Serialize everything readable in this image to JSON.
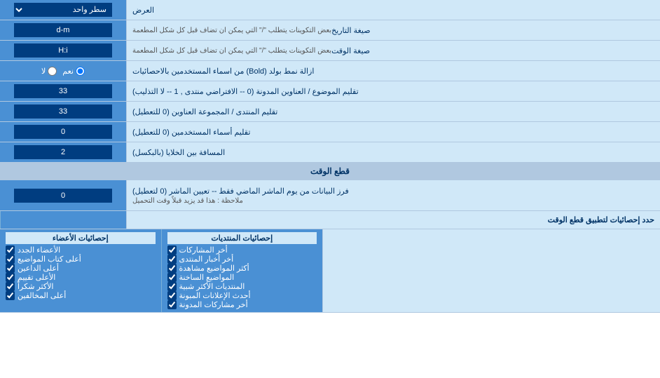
{
  "page": {
    "title": "العرض",
    "rows": [
      {
        "id": "display_mode",
        "label": "العرض",
        "input_type": "select",
        "value": "سطر واحد"
      },
      {
        "id": "date_format",
        "label": "صيغة التاريخ",
        "sublabel": "بعض التكوينات يتطلب \"/\" التي يمكن ان تضاف قبل كل شكل المطعمة",
        "input_type": "text",
        "value": "d-m"
      },
      {
        "id": "time_format",
        "label": "صيغة الوقت",
        "sublabel": "بعض التكوينات يتطلب \"/\" التي يمكن ان تضاف قبل كل شكل المطعمة",
        "input_type": "text",
        "value": "H:i"
      },
      {
        "id": "bold_remove",
        "label": "ازالة نمط بولد (Bold) من اسماء المستخدمين بالاحصائيات",
        "input_type": "radio",
        "options": [
          "نعم",
          "لا"
        ],
        "selected": "نعم"
      },
      {
        "id": "topic_subject_align",
        "label": "تقليم الموضوع / العناوين المدونة (0 -- الافتراضي منتدى , 1 -- لا التذليب)",
        "input_type": "text",
        "value": "33"
      },
      {
        "id": "forum_header_align",
        "label": "تقليم المنتدى / المجموعة العناوين (0 للتعطيل)",
        "input_type": "text",
        "value": "33"
      },
      {
        "id": "username_trim",
        "label": "تقليم أسماء المستخدمين (0 للتعطيل)",
        "input_type": "text",
        "value": "0"
      },
      {
        "id": "cell_spacing",
        "label": "المسافة بين الخلايا (بالبكسل)",
        "input_type": "text",
        "value": "2"
      }
    ],
    "realtime_section": {
      "title": "قطع الوقت",
      "realtime_row": {
        "label": "فرز البيانات من يوم الماشر الماضي فقط -- تعيين الماشر (0 لتعطيل)",
        "note": "ملاحظة : هذا قد يزيد قبلاً وقت التحميل",
        "value": "0"
      },
      "apply_label": "حدد إحصائيات لتطبيق قطع الوقت"
    },
    "checkboxes": {
      "col1_header": "إحصائيات المنتديات",
      "col2_header": "إحصائيات الأعضاء",
      "col1_items": [
        "أخر المشاركات",
        "أخر أخبار المنتدى",
        "أكثر المواضيع مشاهدة",
        "المواضيع الساخنة",
        "المنتديات الأكثر شبية",
        "أحدث الإعلانات المبونة",
        "أخر مشاركات المدونة"
      ],
      "col2_items": [
        "الأعضاء الجدد",
        "أعلى كتاب المواضيع",
        "أعلى الداعين",
        "الأعلى تقييم",
        "الأكثر شكراً",
        "أعلى المخالفين"
      ]
    }
  }
}
